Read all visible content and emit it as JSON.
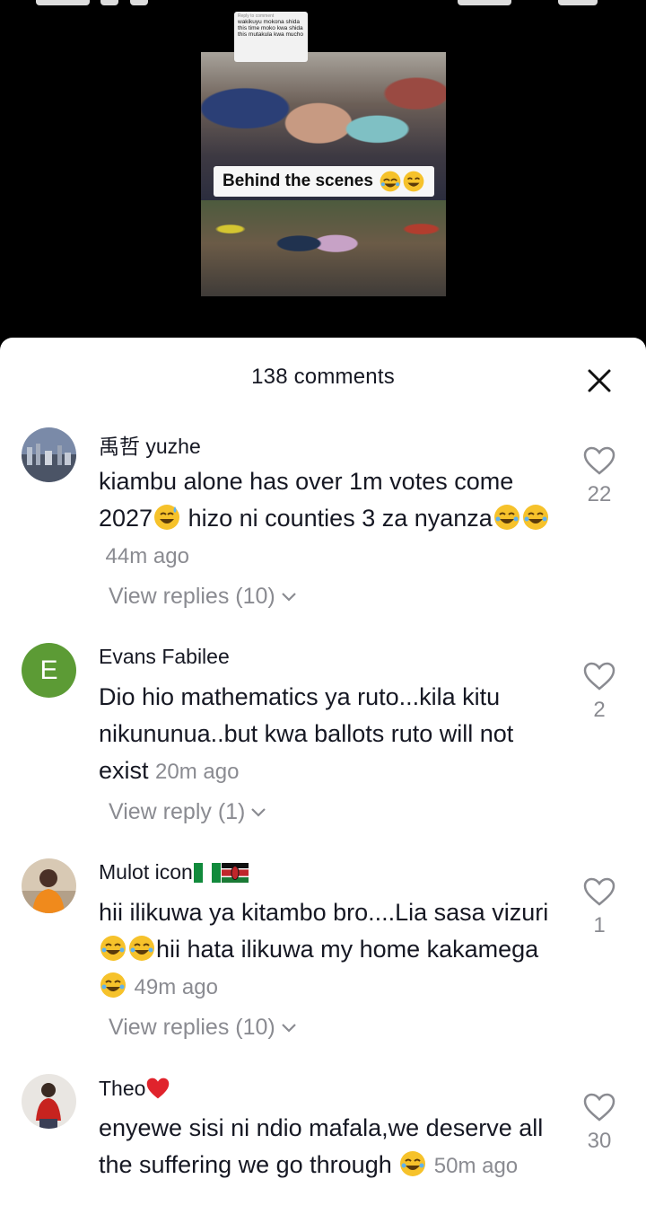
{
  "video": {
    "caption": "Behind the scenes",
    "reply_sticker_header": "Reply to comment",
    "reply_sticker_text": "wakikuyu mokona shida this time moko kwa shida this mutakula kwa mucho"
  },
  "sheet": {
    "title": "138 comments"
  },
  "comments": [
    {
      "username": "禹哲 yuzhe",
      "text_a": "kiambu alone has over 1m votes come 2027",
      "text_b": " hizo ni counties 3 za nyanza",
      "time": "44m ago",
      "replies": "View replies (10)",
      "likes": "22"
    },
    {
      "username": "Evans Fabilee",
      "avatar_letter": "E",
      "text_a": "Dio hio mathematics ya ruto...kila kitu nikununua..but kwa ballots ruto will not exist",
      "time": "20m ago",
      "replies": "View reply (1)",
      "likes": "2"
    },
    {
      "username": "Mulot icon",
      "text_a": "hii ilikuwa ya kitambo bro....Lia sasa vizuri",
      "text_b": "hii hata ilikuwa my home kakamega ",
      "time": "49m ago",
      "replies": "View replies (10)",
      "likes": "1"
    },
    {
      "username": "Theo",
      "text_a": "enyewe sisi ni ndio mafala,we deserve all the suffering we go through ",
      "time": "50m ago",
      "likes": "30"
    }
  ],
  "colors": {
    "accent_avatar": "#5c9b35",
    "muted_text": "#8a8b91",
    "primary_text": "#161823"
  }
}
